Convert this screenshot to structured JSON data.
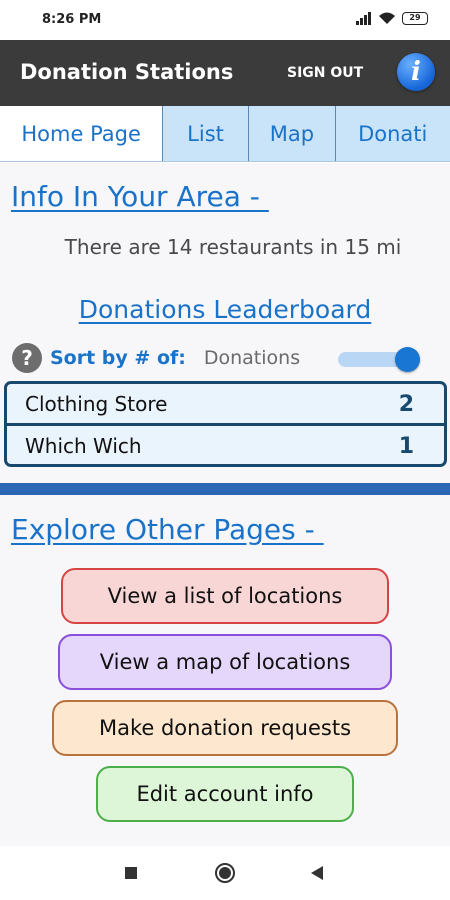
{
  "status_bar": {
    "time": "8:26 PM",
    "battery": "29",
    "icons": [
      "signal-icon",
      "wifi-icon",
      "battery-icon"
    ]
  },
  "app_bar": {
    "title": "Donation Stations",
    "sign_out": "SIGN OUT",
    "info_icon_glyph": "i",
    "info_icon_color": "#1565d8"
  },
  "tabs": [
    {
      "label": "Home Page",
      "active": true
    },
    {
      "label": "List",
      "active": false
    },
    {
      "label": "Map",
      "active": false
    },
    {
      "label": "Donati",
      "active": false
    }
  ],
  "info_section": {
    "title": "Info In Your Area - ",
    "text": "There are 14 restaurants in 15 mi"
  },
  "leaderboard": {
    "title": "Donations Leaderboard",
    "help_glyph": "?",
    "sort_label": "Sort by # of:",
    "sort_value": "Donations",
    "toggle_on": true,
    "rows": [
      {
        "name": "Clothing Store",
        "count": "2"
      },
      {
        "name": "Which Wich",
        "count": "1"
      }
    ]
  },
  "explore_section": {
    "title": "Explore Other Pages - ",
    "buttons": {
      "list": "View a list of locations",
      "map": "View a map of locations",
      "requests": "Make donation requests",
      "account": "Edit account info"
    }
  },
  "colors": {
    "accent": "#1a73c9",
    "app_bar": "#3b3b3b",
    "tab_bar": "#c9e3f8",
    "divider": "#2a68b6",
    "table_border": "#17486e"
  },
  "nav_bar": {
    "icons": [
      "recents-square-icon",
      "home-circle-icon",
      "back-triangle-icon"
    ]
  }
}
